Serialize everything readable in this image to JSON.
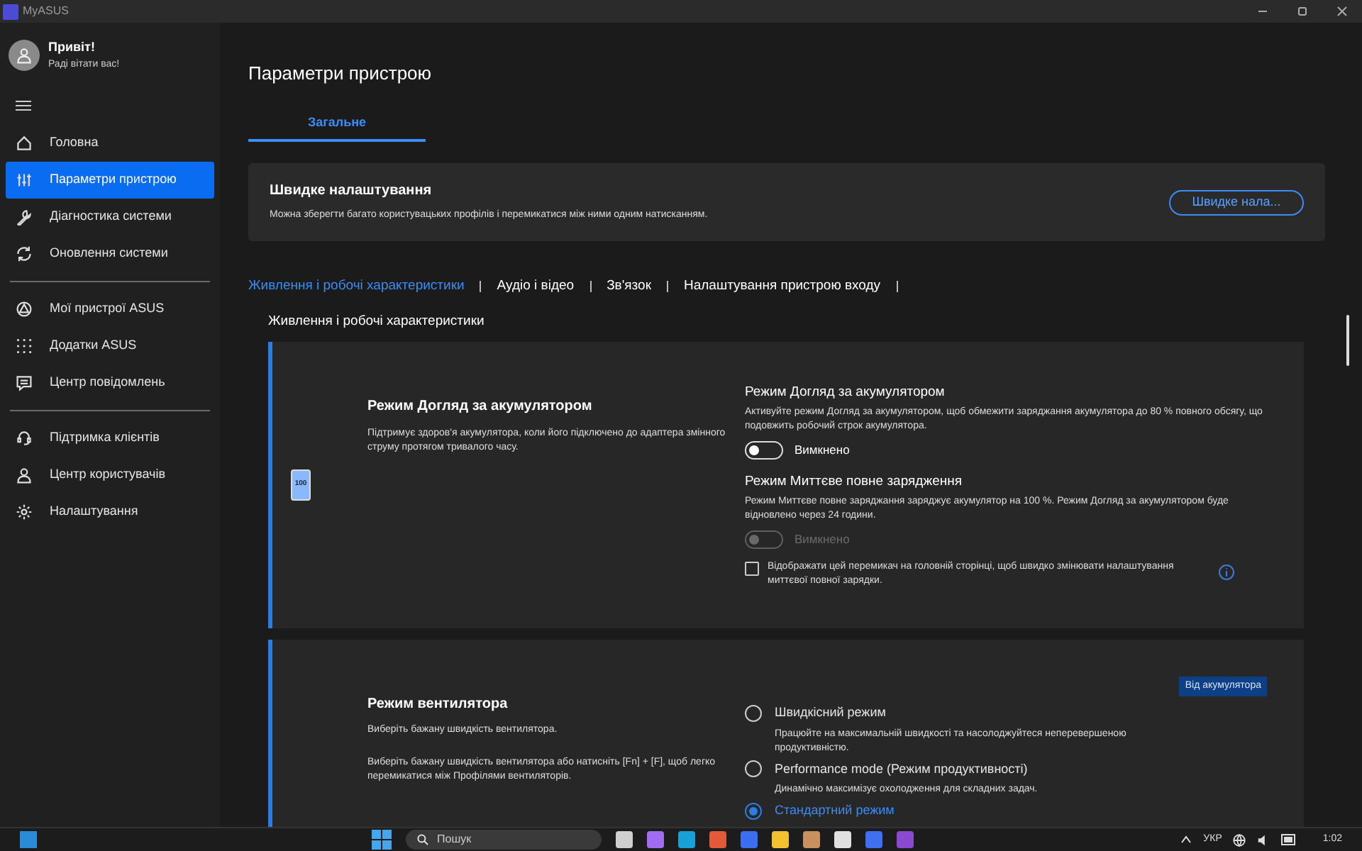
{
  "window": {
    "title": "MyASUS"
  },
  "user": {
    "greeting": "Привіт!",
    "subtitle": "Раді вітати вас!"
  },
  "sidebar": {
    "groups": [
      [
        {
          "label": "Головна",
          "selected": false
        },
        {
          "label": "Параметри пристрою",
          "selected": true
        },
        {
          "label": "Діагностика системи",
          "selected": false
        },
        {
          "label": "Оновлення системи",
          "selected": false
        }
      ],
      [
        {
          "label": "Мої пристрої ASUS",
          "selected": false
        },
        {
          "label": "Додатки ASUS",
          "selected": false
        },
        {
          "label": "Центр повідомлень",
          "selected": false
        }
      ],
      [
        {
          "label": "Підтримка клієнтів",
          "selected": false
        },
        {
          "label": "Центр користувачів",
          "selected": false
        },
        {
          "label": "Налаштування",
          "selected": false
        }
      ]
    ]
  },
  "page_title": "Параметри пристрою",
  "tabs": [
    {
      "label": "Загальне",
      "selected": true
    }
  ],
  "quick_settings": {
    "title": "Швидке налаштування",
    "description": "Можна зберегти багато користувацьких профілів і перемикатися між ними одним натисканням.",
    "button": "Швидке нала..."
  },
  "section_tabs": [
    {
      "label": "Живлення і робочі характеристики",
      "selected": true
    },
    {
      "label": "Аудіо і відео",
      "selected": false
    },
    {
      "label": "Зв'язок",
      "selected": false
    },
    {
      "label": "Налаштування пристрою входу",
      "selected": false
    }
  ],
  "section_heading": "Живлення і робочі характеристики",
  "battery_card": {
    "title": "Режим Догляд за акумулятором",
    "description": "Підтримує здоров'я акумулятора, коли його підключено до адаптера змінного струму протягом тривалого часу.",
    "icon_label": "100",
    "settings": [
      {
        "title": "Режим Догляд за акумулятором",
        "description": "Активуйте режим Догляд за акумулятором, щоб обмежити заряджання акумулятора до 80 % повного обсягу, що подовжить робочий строк акумулятора.",
        "on": false,
        "disabled": false,
        "state_label": "Вимкнено"
      },
      {
        "title": "Режим Миттєве повне зарядження",
        "description": "Режим Миттєве повне заряджання заряджує акумулятор на 100 %. Режим Догляд за акумулятором буде відновлено через 24 години.",
        "on": false,
        "disabled": true,
        "state_label": "Вимкнено"
      }
    ],
    "checkbox": {
      "label": "Відображати цей перемикач на головній сторінці, щоб швидко змінювати налаштування миттєвої повної зарядки.",
      "checked": false
    }
  },
  "fan_card": {
    "title": "Режим вентилятора",
    "description": "Виберіть бажану швидкість вентилятора.",
    "note": "Виберіть бажану швидкість вентилятора або натисніть [Fn] + [F], щоб легко перемикатися між Профілями вентиляторів.",
    "badge": "Від акумулятора",
    "options": [
      {
        "label": "Швидкісний режим",
        "description": "Працюйте на максимальній швидкості та насолоджуйтеся неперевершеною продуктивністю.",
        "selected": false
      },
      {
        "label": "Performance mode (Режим продуктивності)",
        "description": "Динамічно максимізує охолодження для складних задач.",
        "selected": false
      },
      {
        "label": "Стандартний режим",
        "selected": true
      }
    ]
  },
  "taskbar": {
    "search_placeholder": "Пошук",
    "language": "УКР",
    "time": "1:02"
  }
}
